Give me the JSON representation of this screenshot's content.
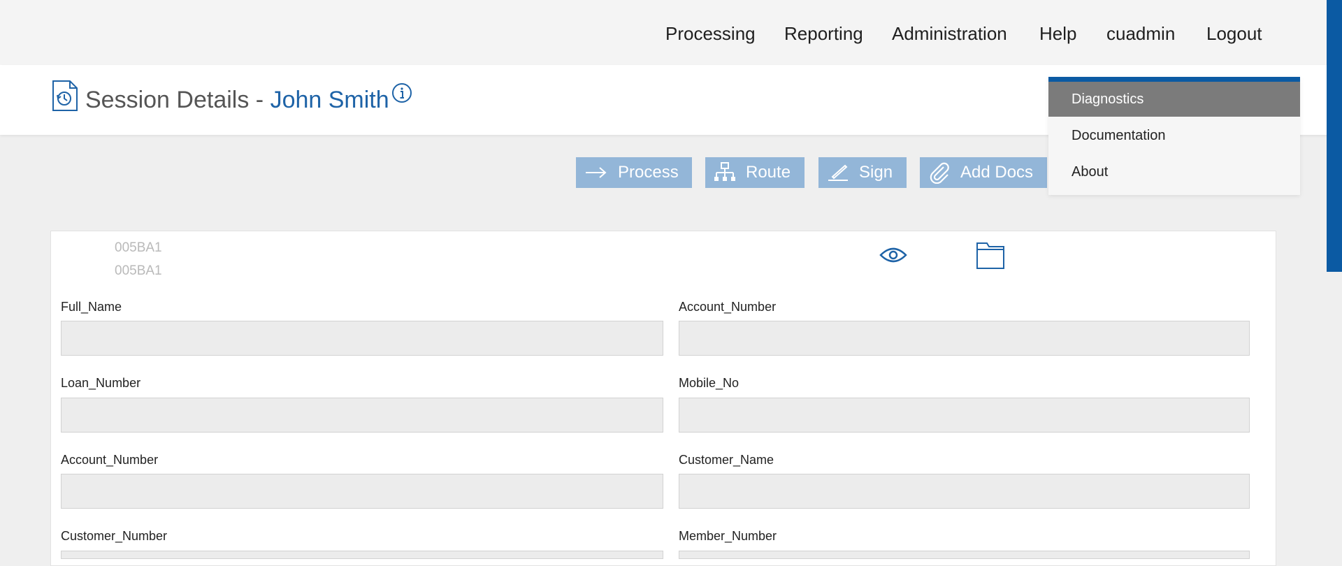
{
  "nav": {
    "items": [
      "Processing",
      "Reporting",
      "Administration",
      "Help",
      "cuadmin",
      "Logout"
    ]
  },
  "page": {
    "title_prefix": "Session Details -",
    "title_name": "John Smith"
  },
  "actions": {
    "process": "Process",
    "route": "Route",
    "sign": "Sign",
    "add_docs": "Add Docs"
  },
  "help_menu": {
    "items": [
      "Diagnostics",
      "Documentation",
      "About"
    ],
    "active_item": "Diagnostics"
  },
  "document": {
    "ids": [
      "005BA1",
      "005BA1"
    ]
  },
  "form": {
    "fields": [
      {
        "label": "Full_Name",
        "value": ""
      },
      {
        "label": "Account_Number",
        "value": ""
      },
      {
        "label": "Loan_Number",
        "value": ""
      },
      {
        "label": "Mobile_No",
        "value": ""
      },
      {
        "label": "Account_Number",
        "value": ""
      },
      {
        "label": "Customer_Name",
        "value": ""
      },
      {
        "label": "Customer_Number",
        "value": ""
      },
      {
        "label": "Member_Number",
        "value": ""
      }
    ]
  },
  "colors": {
    "accent": "#1e63a7",
    "action_button": "#93b6d8",
    "menu_active": "#7b7b7b",
    "menu_border": "#0b5aa3"
  },
  "icons": [
    "session-history-icon",
    "info-icon",
    "arrow-right-icon",
    "route-hierarchy-icon",
    "pen-sign-icon",
    "paperclip-icon",
    "eye-icon",
    "folder-icon"
  ]
}
